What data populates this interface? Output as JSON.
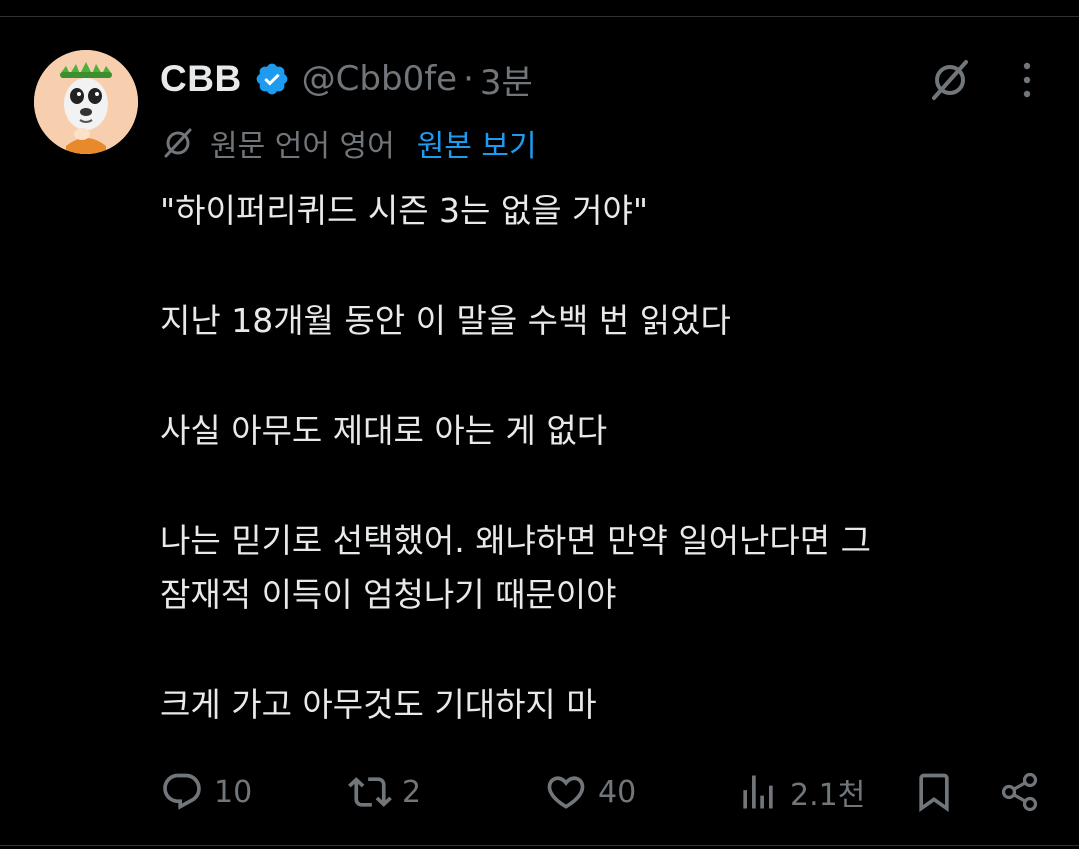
{
  "author": {
    "name": "CBB",
    "handle": "@Cbb0fe",
    "separator": "·",
    "time": "3분",
    "verified": true
  },
  "translation": {
    "label": "원문 언어 영어",
    "original_link": "원본 보기"
  },
  "tweet": {
    "paragraphs": [
      [
        "\"하이퍼리퀴드 시즌 3는 없을 거야\""
      ],
      [
        "지난 18개월 동안 이 말을 수백 번 읽었다"
      ],
      [
        "사실 아무도 제대로 아는 게 없다"
      ],
      [
        "나는 믿기로 선택했어. 왜냐하면 만약 일어난다면 그",
        "잠재적 이득이 엄청나기 때문이야"
      ],
      [
        "크게 가고 아무것도 기대하지 마"
      ]
    ]
  },
  "actions": {
    "replies": "10",
    "reposts": "2",
    "likes": "40",
    "views": "2.1천"
  },
  "colors": {
    "background": "#000000",
    "text": "#e7e9ea",
    "muted": "#71767b",
    "link": "#1d9bf0",
    "verified": "#1d9bf0"
  },
  "icons": [
    "verified-badge-icon",
    "grok-icon",
    "more-icon",
    "translate-icon",
    "reply-icon",
    "repost-icon",
    "like-icon",
    "views-icon",
    "bookmark-icon",
    "share-icon"
  ]
}
